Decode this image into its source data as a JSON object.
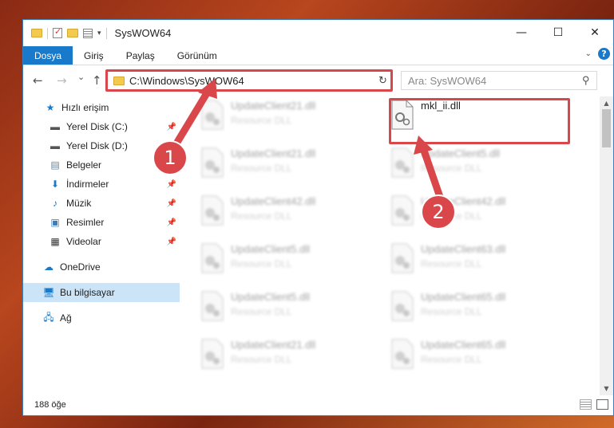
{
  "window": {
    "title": "SysWOW64",
    "controls": {
      "minimize": "—",
      "maximize": "☐",
      "close": "✕"
    }
  },
  "ribbon": {
    "tabs": [
      {
        "label": "Dosya",
        "active": true
      },
      {
        "label": "Giriş",
        "active": false
      },
      {
        "label": "Paylaş",
        "active": false
      },
      {
        "label": "Görünüm",
        "active": false
      }
    ],
    "help": "?"
  },
  "navigation": {
    "back": "←",
    "forward": "→",
    "recent": "⌄",
    "up": "↑",
    "address": "C:\\Windows\\SysWOW64",
    "refresh": "↻",
    "search_placeholder": "Ara: SysWOW64"
  },
  "sidebar": {
    "items": [
      {
        "label": "Hızlı erişim",
        "icon": "star-icon",
        "pinned": false,
        "selected": false
      },
      {
        "label": "Yerel Disk (C:)",
        "icon": "drive-icon",
        "pinned": true,
        "selected": false
      },
      {
        "label": "Yerel Disk (D:)",
        "icon": "drive-icon",
        "pinned": true,
        "selected": false
      },
      {
        "label": "Belgeler",
        "icon": "document-icon",
        "pinned": true,
        "selected": false
      },
      {
        "label": "İndirmeler",
        "icon": "download-icon",
        "pinned": true,
        "selected": false
      },
      {
        "label": "Müzik",
        "icon": "music-icon",
        "pinned": true,
        "selected": false
      },
      {
        "label": "Resimler",
        "icon": "pictures-icon",
        "pinned": true,
        "selected": false
      },
      {
        "label": "Videolar",
        "icon": "video-icon",
        "pinned": true,
        "selected": false
      },
      {
        "label": "OneDrive",
        "icon": "cloud-icon",
        "pinned": false,
        "selected": false
      },
      {
        "label": "Bu bilgisayar",
        "icon": "computer-icon",
        "pinned": false,
        "selected": true
      },
      {
        "label": "Ağ",
        "icon": "network-icon",
        "pinned": false,
        "selected": false
      }
    ]
  },
  "files": {
    "left_column": [
      {
        "name": "UpdateClient21.dll",
        "desc": "Resource DLL"
      },
      {
        "name": "UpdateClient21.dll",
        "desc": "Resource DLL"
      },
      {
        "name": "UpdateClient42.dll",
        "desc": "Resource DLL"
      },
      {
        "name": "UpdateClient5.dll",
        "desc": "Resource DLL"
      },
      {
        "name": "UpdateClient5.dll",
        "desc": "Resource DLL"
      },
      {
        "name": "UpdateClient21.dll",
        "desc": "Resource DLL"
      }
    ],
    "right_column": [
      {
        "name": "mkl_ii.dll",
        "desc": ""
      },
      {
        "name": "UpdateClient5.dll",
        "desc": "Resource DLL"
      },
      {
        "name": "UpdateClient42.dll",
        "desc": "Resource DLL"
      },
      {
        "name": "UpdateClient63.dll",
        "desc": "Resource DLL"
      },
      {
        "name": "UpdateClient65.dll",
        "desc": "Resource DLL"
      },
      {
        "name": "UpdateClient65.dll",
        "desc": "Resource DLL"
      }
    ]
  },
  "status": {
    "item_count": "188 öğe"
  },
  "callouts": {
    "one": "1",
    "two": "2"
  },
  "colors": {
    "accent": "#1979ca",
    "highlight": "#d9474a",
    "selected": "#cce4f7"
  }
}
